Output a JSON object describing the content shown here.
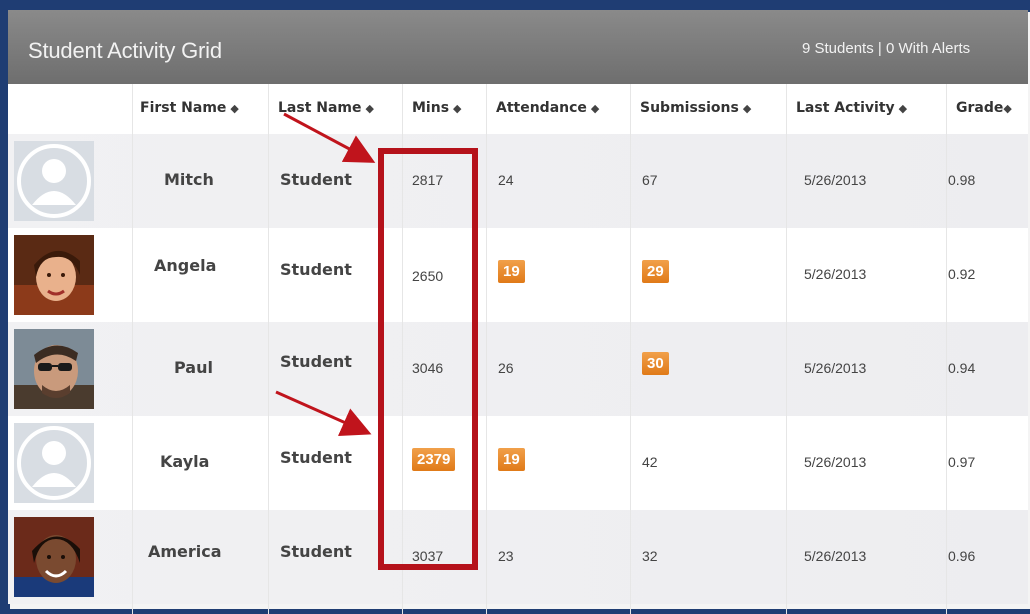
{
  "grid": {
    "title": "Student Activity Grid",
    "summary": "9 Students | 0 With Alerts"
  },
  "columns": [
    {
      "key": "first",
      "label": "First Name"
    },
    {
      "key": "last",
      "label": "Last Name"
    },
    {
      "key": "mins",
      "label": "Mins"
    },
    {
      "key": "attendance",
      "label": "Attendance"
    },
    {
      "key": "submissions",
      "label": "Submissions"
    },
    {
      "key": "last_activity",
      "label": "Last Activity"
    },
    {
      "key": "grade",
      "label": "Grade"
    }
  ],
  "sort_icon": "sort-arrows-icon",
  "rows": [
    {
      "first": "Mitch",
      "last": "Student",
      "mins": "2817",
      "attendance": "24",
      "submissions": "67",
      "last_activity": "5/26/2013",
      "grade": "0.98",
      "avatar": "default-avatar-icon"
    },
    {
      "first": "Angela",
      "last": "Student",
      "mins": "2650",
      "attendance": "19",
      "submissions": "29",
      "last_activity": "5/26/2013",
      "grade": "0.92",
      "avatar": "photo"
    },
    {
      "first": "Paul",
      "last": "Student",
      "mins": "3046",
      "attendance": "26",
      "submissions": "30",
      "last_activity": "5/26/2013",
      "grade": "0.94",
      "avatar": "photo"
    },
    {
      "first": "Kayla",
      "last": "Student",
      "mins": "2379",
      "attendance": "19",
      "submissions": "42",
      "last_activity": "5/26/2013",
      "grade": "0.97",
      "avatar": "default-avatar-icon"
    },
    {
      "first": "America",
      "last": "Student",
      "mins": "3037",
      "attendance": "23",
      "submissions": "32",
      "last_activity": "5/26/2013",
      "grade": "0.96",
      "avatar": "photo"
    }
  ],
  "colors": {
    "titlebar": "#7a7a7a",
    "alert_badge": "#e8862a",
    "highlight": "#b5121b",
    "frame": "#1f3d73"
  }
}
